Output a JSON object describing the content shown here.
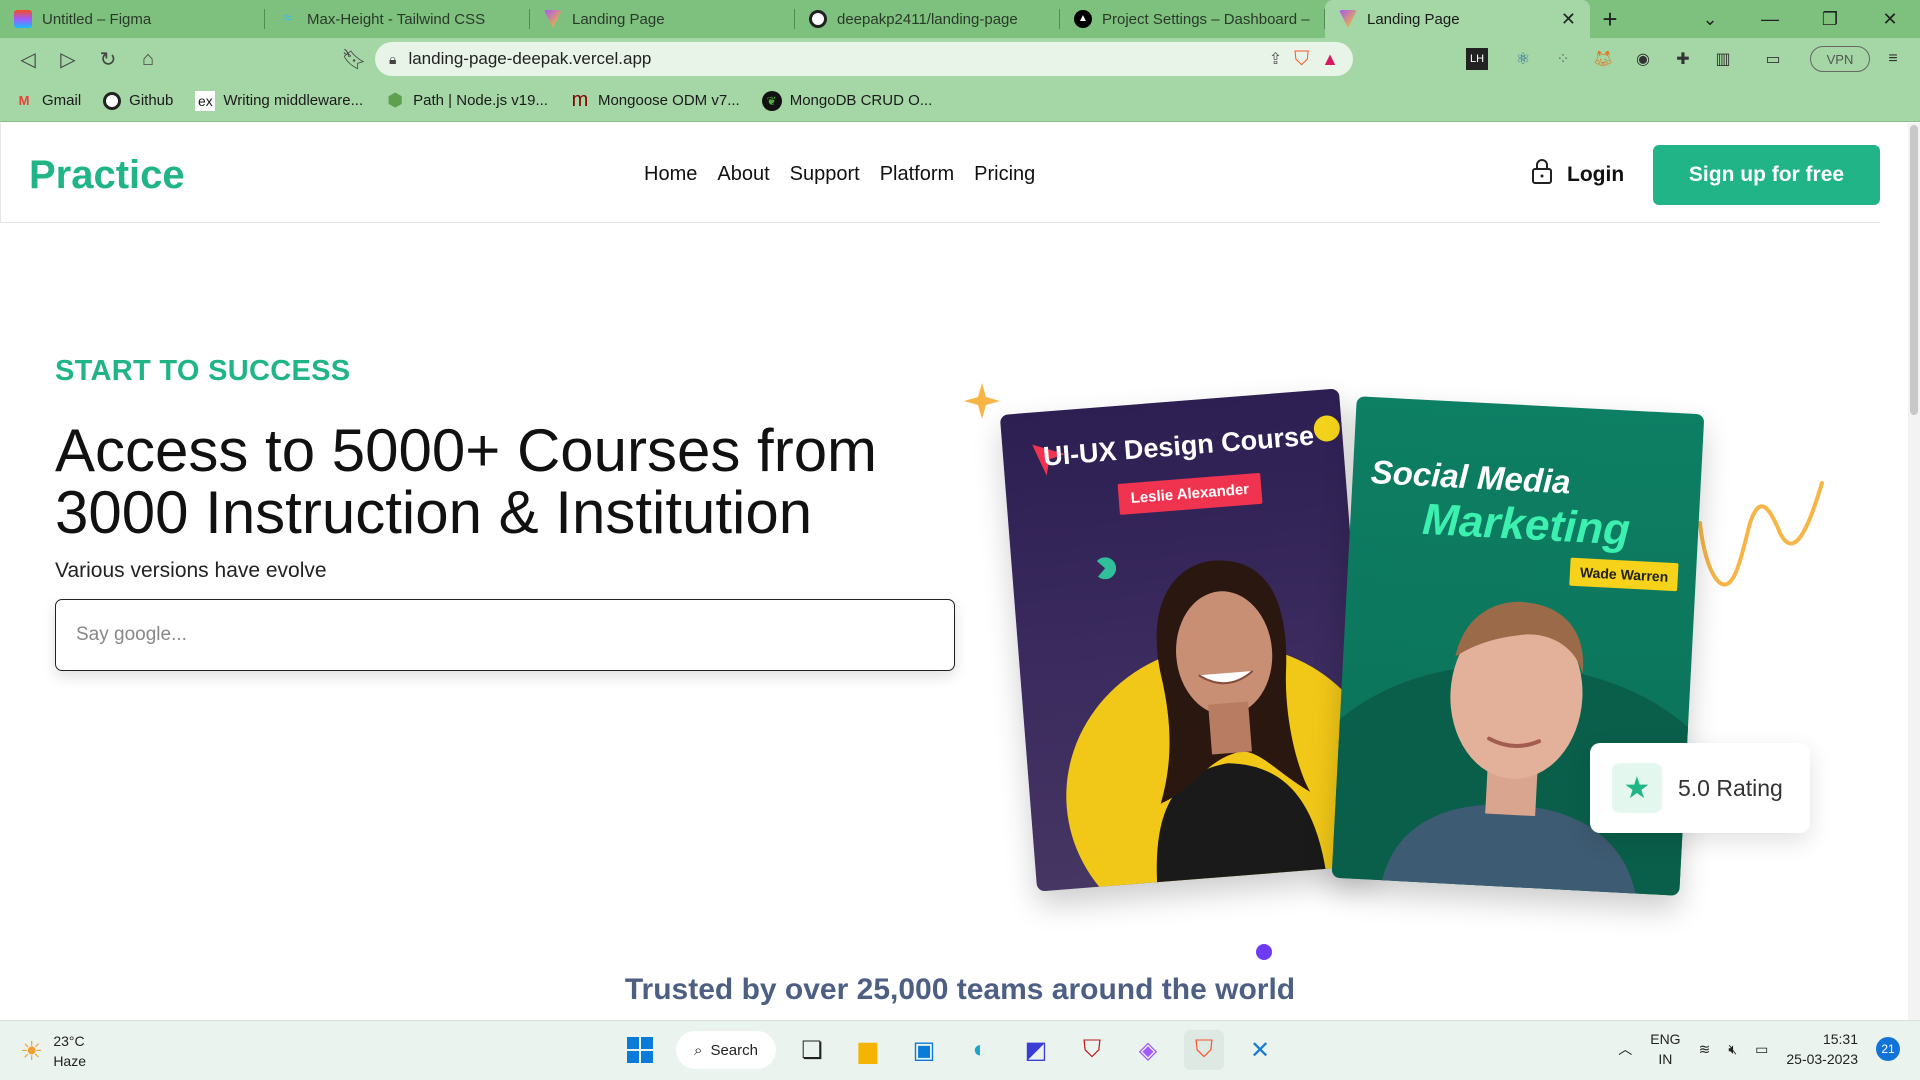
{
  "browser": {
    "tabs": [
      {
        "title": "Untitled – Figma",
        "icon": "figma-icon",
        "color": "#f24e1e"
      },
      {
        "title": "Max-Height - Tailwind CSS",
        "icon": "tailwind-icon",
        "color": "#38bdf8"
      },
      {
        "title": "Landing Page",
        "icon": "vite-icon",
        "color": "#a855f7"
      },
      {
        "title": "deepakp2411/landing-page",
        "icon": "github-icon",
        "color": "#111111"
      },
      {
        "title": "Project Settings – Dashboard – V",
        "icon": "vercel-icon",
        "color": "#000000"
      },
      {
        "title": "Landing Page",
        "icon": "vite-icon",
        "color": "#a855f7",
        "active": true
      }
    ],
    "url": "landing-page-deepak.vercel.app",
    "vpn_label": "VPN",
    "bookmarks": [
      {
        "label": "Gmail",
        "icon": "gmail-icon"
      },
      {
        "label": "Github",
        "icon": "github-icon"
      },
      {
        "label": "Writing middleware...",
        "icon": "express-icon",
        "glyph": "ex"
      },
      {
        "label": "Path | Node.js v19...",
        "icon": "nodejs-icon"
      },
      {
        "label": "Mongoose ODM v7...",
        "icon": "mongoose-icon",
        "glyph": "m"
      },
      {
        "label": "MongoDB CRUD O...",
        "icon": "mongodb-icon"
      }
    ]
  },
  "site": {
    "logo": "Practice",
    "nav": [
      "Home",
      "About",
      "Support",
      "Platform",
      "Pricing"
    ],
    "login_label": "Login",
    "signup_label": "Sign up for free",
    "brand_color": "#20b486"
  },
  "hero": {
    "eyebrow": "START TO SUCCESS",
    "headline": "Access to 5000+ Courses from 3000 Instruction & Institution",
    "subtitle": "Various versions have evolve",
    "search_placeholder": "Say google...",
    "card1": {
      "title": "UI-UX Design Course",
      "instructor": "Leslie Alexander"
    },
    "card2": {
      "title_line1": "Social Media",
      "title_line2": "Marketing",
      "instructor": "Wade Warren"
    },
    "rating": "5.0  Rating"
  },
  "trusted": "Trusted by over 25,000 teams around the world",
  "taskbar": {
    "temp": "23°C",
    "weather": "Haze",
    "search_label": "Search",
    "lang_top": "ENG",
    "lang_bottom": "IN",
    "time": "15:31",
    "date": "25-03-2023",
    "notifications": "21"
  }
}
